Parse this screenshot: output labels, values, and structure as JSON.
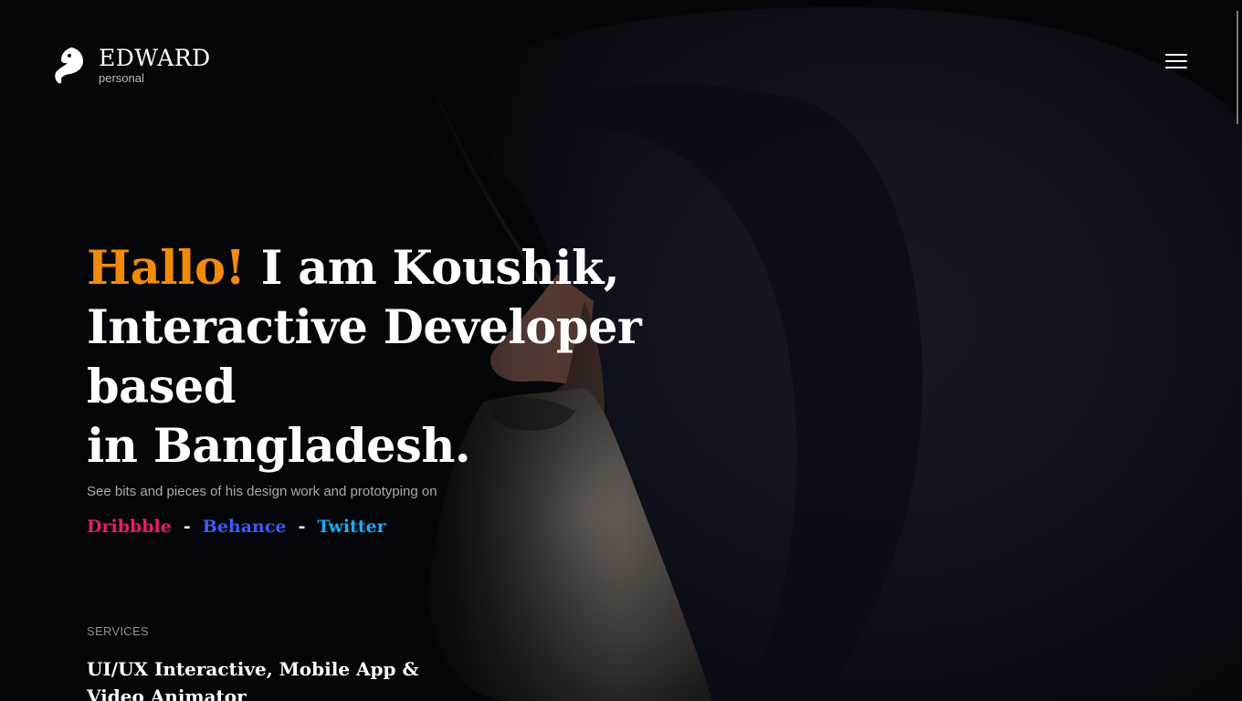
{
  "brand": {
    "name": "EDWARD",
    "subtitle": "personal",
    "logo_icon": "horse-head-icon"
  },
  "header": {
    "menu_icon": "hamburger-menu-icon"
  },
  "hero": {
    "greeting": "Hallo!",
    "line1_rest": " I am Koushik,",
    "line2": "Interactive Developer based",
    "line3": "in Bangladesh.",
    "intro": "See bits and pieces of his design work and prototyping on",
    "accent_color": "#f28b0c"
  },
  "socials": [
    {
      "label": "Dribbble",
      "color": "#ea1e63"
    },
    {
      "label": "Behance",
      "color": "#3b5cf6"
    },
    {
      "label": "Twitter",
      "color": "#1da9f2"
    }
  ],
  "separator": "-",
  "services": {
    "label": "SERVICES",
    "text": "UI/UX Interactive, Mobile App & Video Animator"
  }
}
